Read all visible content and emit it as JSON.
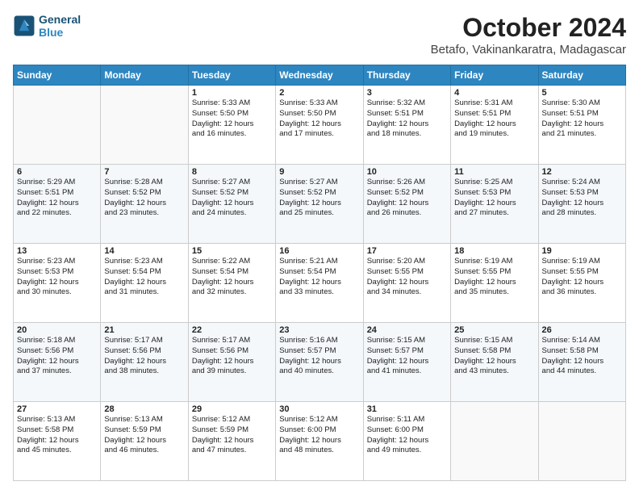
{
  "logo": {
    "line1": "General",
    "line2": "Blue"
  },
  "title": "October 2024",
  "location": "Betafo, Vakinankaratra, Madagascar",
  "weekdays": [
    "Sunday",
    "Monday",
    "Tuesday",
    "Wednesday",
    "Thursday",
    "Friday",
    "Saturday"
  ],
  "rows": [
    [
      {
        "day": "",
        "info": ""
      },
      {
        "day": "",
        "info": ""
      },
      {
        "day": "1",
        "info": "Sunrise: 5:33 AM\nSunset: 5:50 PM\nDaylight: 12 hours\nand 16 minutes."
      },
      {
        "day": "2",
        "info": "Sunrise: 5:33 AM\nSunset: 5:50 PM\nDaylight: 12 hours\nand 17 minutes."
      },
      {
        "day": "3",
        "info": "Sunrise: 5:32 AM\nSunset: 5:51 PM\nDaylight: 12 hours\nand 18 minutes."
      },
      {
        "day": "4",
        "info": "Sunrise: 5:31 AM\nSunset: 5:51 PM\nDaylight: 12 hours\nand 19 minutes."
      },
      {
        "day": "5",
        "info": "Sunrise: 5:30 AM\nSunset: 5:51 PM\nDaylight: 12 hours\nand 21 minutes."
      }
    ],
    [
      {
        "day": "6",
        "info": "Sunrise: 5:29 AM\nSunset: 5:51 PM\nDaylight: 12 hours\nand 22 minutes."
      },
      {
        "day": "7",
        "info": "Sunrise: 5:28 AM\nSunset: 5:52 PM\nDaylight: 12 hours\nand 23 minutes."
      },
      {
        "day": "8",
        "info": "Sunrise: 5:27 AM\nSunset: 5:52 PM\nDaylight: 12 hours\nand 24 minutes."
      },
      {
        "day": "9",
        "info": "Sunrise: 5:27 AM\nSunset: 5:52 PM\nDaylight: 12 hours\nand 25 minutes."
      },
      {
        "day": "10",
        "info": "Sunrise: 5:26 AM\nSunset: 5:52 PM\nDaylight: 12 hours\nand 26 minutes."
      },
      {
        "day": "11",
        "info": "Sunrise: 5:25 AM\nSunset: 5:53 PM\nDaylight: 12 hours\nand 27 minutes."
      },
      {
        "day": "12",
        "info": "Sunrise: 5:24 AM\nSunset: 5:53 PM\nDaylight: 12 hours\nand 28 minutes."
      }
    ],
    [
      {
        "day": "13",
        "info": "Sunrise: 5:23 AM\nSunset: 5:53 PM\nDaylight: 12 hours\nand 30 minutes."
      },
      {
        "day": "14",
        "info": "Sunrise: 5:23 AM\nSunset: 5:54 PM\nDaylight: 12 hours\nand 31 minutes."
      },
      {
        "day": "15",
        "info": "Sunrise: 5:22 AM\nSunset: 5:54 PM\nDaylight: 12 hours\nand 32 minutes."
      },
      {
        "day": "16",
        "info": "Sunrise: 5:21 AM\nSunset: 5:54 PM\nDaylight: 12 hours\nand 33 minutes."
      },
      {
        "day": "17",
        "info": "Sunrise: 5:20 AM\nSunset: 5:55 PM\nDaylight: 12 hours\nand 34 minutes."
      },
      {
        "day": "18",
        "info": "Sunrise: 5:19 AM\nSunset: 5:55 PM\nDaylight: 12 hours\nand 35 minutes."
      },
      {
        "day": "19",
        "info": "Sunrise: 5:19 AM\nSunset: 5:55 PM\nDaylight: 12 hours\nand 36 minutes."
      }
    ],
    [
      {
        "day": "20",
        "info": "Sunrise: 5:18 AM\nSunset: 5:56 PM\nDaylight: 12 hours\nand 37 minutes."
      },
      {
        "day": "21",
        "info": "Sunrise: 5:17 AM\nSunset: 5:56 PM\nDaylight: 12 hours\nand 38 minutes."
      },
      {
        "day": "22",
        "info": "Sunrise: 5:17 AM\nSunset: 5:56 PM\nDaylight: 12 hours\nand 39 minutes."
      },
      {
        "day": "23",
        "info": "Sunrise: 5:16 AM\nSunset: 5:57 PM\nDaylight: 12 hours\nand 40 minutes."
      },
      {
        "day": "24",
        "info": "Sunrise: 5:15 AM\nSunset: 5:57 PM\nDaylight: 12 hours\nand 41 minutes."
      },
      {
        "day": "25",
        "info": "Sunrise: 5:15 AM\nSunset: 5:58 PM\nDaylight: 12 hours\nand 43 minutes."
      },
      {
        "day": "26",
        "info": "Sunrise: 5:14 AM\nSunset: 5:58 PM\nDaylight: 12 hours\nand 44 minutes."
      }
    ],
    [
      {
        "day": "27",
        "info": "Sunrise: 5:13 AM\nSunset: 5:58 PM\nDaylight: 12 hours\nand 45 minutes."
      },
      {
        "day": "28",
        "info": "Sunrise: 5:13 AM\nSunset: 5:59 PM\nDaylight: 12 hours\nand 46 minutes."
      },
      {
        "day": "29",
        "info": "Sunrise: 5:12 AM\nSunset: 5:59 PM\nDaylight: 12 hours\nand 47 minutes."
      },
      {
        "day": "30",
        "info": "Sunrise: 5:12 AM\nSunset: 6:00 PM\nDaylight: 12 hours\nand 48 minutes."
      },
      {
        "day": "31",
        "info": "Sunrise: 5:11 AM\nSunset: 6:00 PM\nDaylight: 12 hours\nand 49 minutes."
      },
      {
        "day": "",
        "info": ""
      },
      {
        "day": "",
        "info": ""
      }
    ]
  ]
}
